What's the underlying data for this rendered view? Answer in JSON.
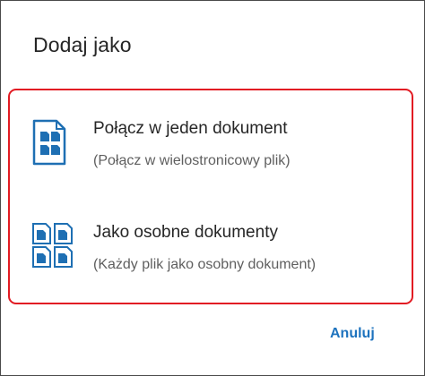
{
  "dialog": {
    "title": "Dodaj jako",
    "options": [
      {
        "icon": "single-document-icon",
        "title": "Połącz w jeden dokument",
        "subtitle": "(Połącz w wielostronicowy plik)"
      },
      {
        "icon": "multiple-documents-icon",
        "title": "Jako osobne dokumenty",
        "subtitle": "(Każdy plik jako osobny dokument)"
      }
    ],
    "cancel_label": "Anuluj"
  },
  "colors": {
    "accent": "#1e73be",
    "highlight_border": "#e21b23",
    "title_text": "#262626",
    "subtitle_text": "#5f5f5f"
  }
}
